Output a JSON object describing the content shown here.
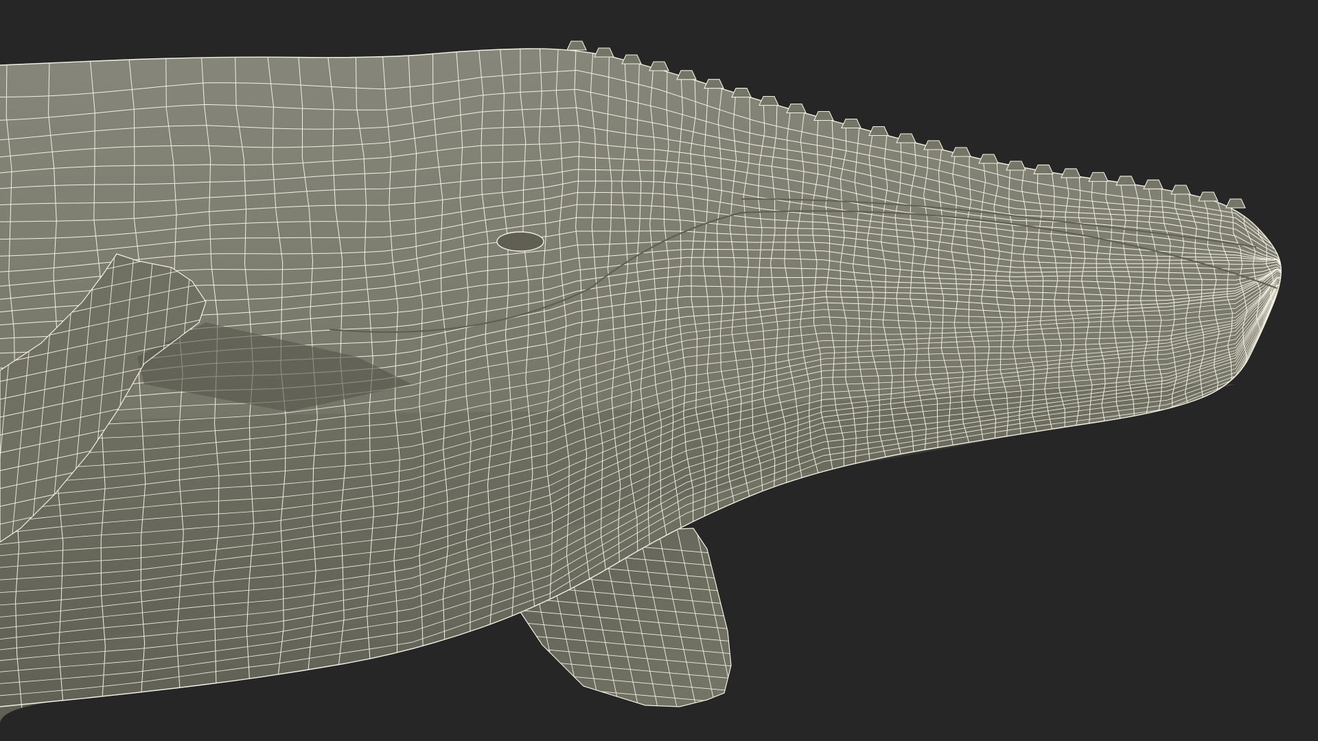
{
  "scene": {
    "subject": "whale-head-wireframe",
    "colors": {
      "background": "#262626",
      "body": "#767668",
      "body_shadow": "#5f5f54",
      "body_highlight": "#86867a",
      "wire": "#f4f1e4"
    }
  }
}
